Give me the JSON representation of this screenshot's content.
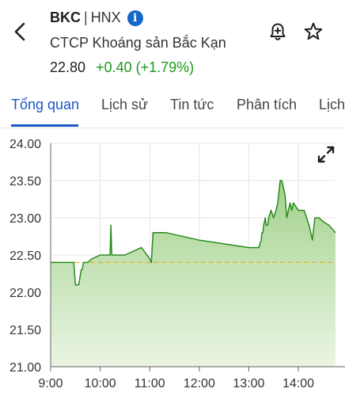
{
  "header": {
    "ticker": "BKC",
    "separator": "|",
    "exchange": "HNX",
    "info_glyph": "i",
    "company_name": "CTCP Khoáng sản Bắc Kạn",
    "price": "22.80",
    "change": "+0.40 (+1.79%)",
    "icons": [
      "back-arrow-icon",
      "info-icon",
      "bell-plus-icon",
      "star-icon"
    ]
  },
  "tabs": [
    {
      "label": "Tổng quan",
      "active": true
    },
    {
      "label": "Lịch sử",
      "active": false
    },
    {
      "label": "Tin tức",
      "active": false
    },
    {
      "label": "Phân tích",
      "active": false
    },
    {
      "label": "Lịch",
      "active": false
    }
  ],
  "colors": {
    "accent": "#1a56c4",
    "up": "#1a9a1a",
    "line": "#2a8a1f",
    "reference": "#e0b020",
    "info": "#1668c7"
  },
  "chart_data": {
    "type": "area",
    "reference_price": 22.4,
    "ylim": [
      21.0,
      24.0
    ],
    "yticks": [
      "21.00",
      "21.50",
      "22.00",
      "22.50",
      "23.00",
      "23.50",
      "24.00"
    ],
    "xticks": [
      "9:00",
      "10:00",
      "11:00",
      "12:00",
      "13:00",
      "14:00"
    ],
    "x_range": [
      "9:00",
      "14:45"
    ],
    "grid": true,
    "series": [
      {
        "x": [
          "9:00",
          "9:15",
          "9:28",
          "9:30",
          "9:34",
          "9:37",
          "9:38",
          "9:40",
          "9:45",
          "9:50",
          "10:00",
          "10:05",
          "10:10",
          "10:12",
          "10:13",
          "10:14",
          "10:16",
          "10:18",
          "10:30",
          "10:50",
          "11:00",
          "11:02",
          "11:03",
          "11:04",
          "11:05",
          "11:20",
          "12:00",
          "12:30",
          "13:00",
          "13:10",
          "13:12",
          "13:15",
          "13:16",
          "13:17",
          "13:18",
          "13:20",
          "13:21",
          "13:23",
          "13:24",
          "13:27",
          "13:30",
          "13:33",
          "13:35",
          "13:36",
          "13:38",
          "13:40",
          "13:42",
          "13:44",
          "13:46",
          "13:48",
          "13:50",
          "13:52",
          "13:54",
          "14:00",
          "14:07",
          "14:10",
          "14:13",
          "14:17",
          "14:20",
          "14:25",
          "14:30",
          "14:37",
          "14:45"
        ],
        "values": [
          22.4,
          22.4,
          22.4,
          22.1,
          22.1,
          22.3,
          22.3,
          22.4,
          22.4,
          22.45,
          22.5,
          22.5,
          22.5,
          22.5,
          22.9,
          22.5,
          22.5,
          22.5,
          22.5,
          22.6,
          22.45,
          22.4,
          22.6,
          22.8,
          22.8,
          22.8,
          22.7,
          22.65,
          22.6,
          22.6,
          22.6,
          22.7,
          22.8,
          22.8,
          22.9,
          23.0,
          22.9,
          22.9,
          23.0,
          23.1,
          23.0,
          23.1,
          23.2,
          23.3,
          23.5,
          23.5,
          23.4,
          23.3,
          23.0,
          23.1,
          23.2,
          23.1,
          23.2,
          23.1,
          23.1,
          23.0,
          22.9,
          22.7,
          23.0,
          23.0,
          22.95,
          22.9,
          22.8
        ]
      }
    ]
  }
}
